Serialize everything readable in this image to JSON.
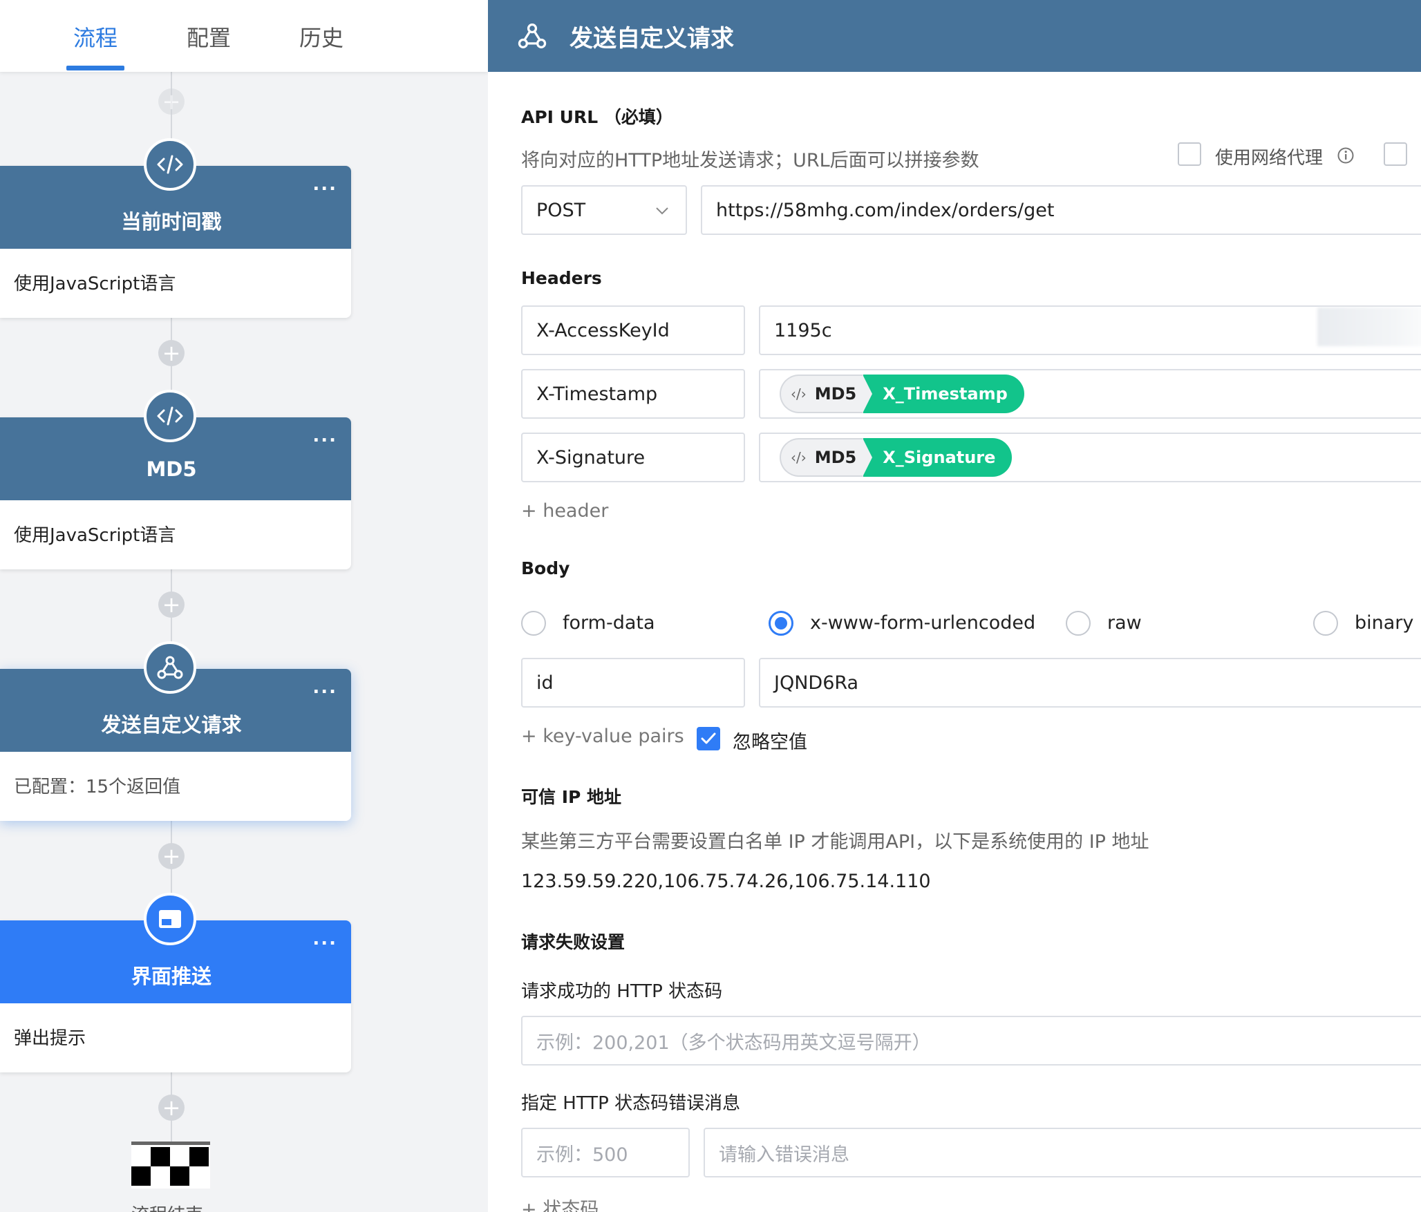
{
  "tabs": [
    {
      "label": "流程"
    },
    {
      "label": "配置"
    },
    {
      "label": "历史"
    }
  ],
  "flow": {
    "nodes": [
      {
        "title": "当前时间戳",
        "subtitle": "使用JavaScript语言",
        "icon": "code-icon",
        "menu": "..."
      },
      {
        "title": "MD5",
        "subtitle": "使用JavaScript语言",
        "icon": "code-icon",
        "menu": "..."
      },
      {
        "title": "发送自定义请求",
        "subtitle": "已配置：15个返回值",
        "icon": "webhook-icon",
        "menu": "..."
      },
      {
        "title": "界面推送",
        "subtitle": "弹出提示",
        "icon": "window-icon",
        "menu": "..."
      }
    ],
    "add_symbol": "+",
    "end_label": "流程结束"
  },
  "panel": {
    "title": "发送自定义请求",
    "icon": "webhook-icon",
    "api_url": {
      "label": "API URL （必填）",
      "description": "将向对应的HTTP地址发送请求；URL后面可以拼接参数",
      "proxy_label": "使用网络代理",
      "method": "POST",
      "url": "https://58mhg.com/index/orders/get"
    },
    "headers": {
      "label": "Headers",
      "rows": [
        {
          "key": "X-AccessKeyId",
          "value": "1195c"
        },
        {
          "key": "X-Timestamp",
          "chip_tag": "‹/›",
          "chip_source": "MD5",
          "chip_var": "X_Timestamp"
        },
        {
          "key": "X-Signature",
          "chip_tag": "‹/›",
          "chip_source": "MD5",
          "chip_var": "X_Signature"
        }
      ],
      "add_label": "+ header"
    },
    "body": {
      "label": "Body",
      "options": [
        {
          "label": "form-data",
          "selected": false
        },
        {
          "label": "x-www-form-urlencoded",
          "selected": true
        },
        {
          "label": "raw",
          "selected": false
        },
        {
          "label": "binary",
          "selected": false
        }
      ],
      "pairs": [
        {
          "key": "id",
          "value": "JQND6Ra"
        }
      ],
      "add_label": "+ key-value pairs",
      "ignore_empty_label": "忽略空值",
      "ignore_empty_checked": true
    },
    "trusted_ip": {
      "label": "可信 IP 地址",
      "description": "某些第三方平台需要设置白名单 IP 才能调用API，以下是系统使用的 IP 地址",
      "value": "123.59.59.220,106.75.74.26,106.75.14.110"
    },
    "failure": {
      "label": "请求失败设置",
      "success_code_label": "请求成功的 HTTP 状态码",
      "success_code_placeholder": "示例：200,201（多个状态码用英文逗号隔开）",
      "error_msg_label": "指定 HTTP 状态码错误消息",
      "code_placeholder": "示例：500",
      "message_placeholder": "请输入错误消息",
      "add_label": "+ 状态码"
    }
  },
  "colors": {
    "header_bg": "#47739a",
    "accent": "#2f7cf6",
    "variable_chip": "#12c48b"
  }
}
